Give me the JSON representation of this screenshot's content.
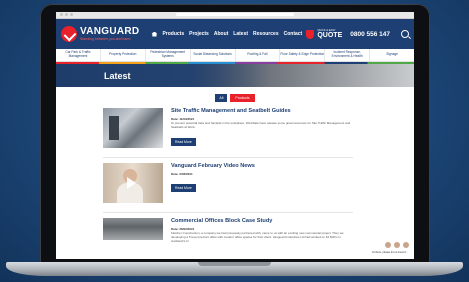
{
  "site": {
    "logo_name": "VANGUARD",
    "logo_tagline": "Standing between you and harm",
    "nav": [
      "Products",
      "Projects",
      "About",
      "Latest",
      "Resources",
      "Contact"
    ],
    "quote_small": "QUICK & EASY",
    "quote_big": "QUOTE",
    "phone": "0800 556 147",
    "categories": [
      "Car Park & Traffic Management",
      "Property Protection",
      "Pedestrian Management Systems",
      "Social Distancing Solutions",
      "Roofing & Fall",
      "Floor Safety & Edge Protection",
      "Incident Response, Environment & Health",
      "Signage"
    ],
    "hero_title": "Latest",
    "filters": {
      "all": "All",
      "products": "Products"
    }
  },
  "articles": [
    {
      "title": "Site Traffic Management and Seatbelt Guides",
      "date": "Date: 11/03/2021",
      "text": "To prevent potential risks and hazards in the workplace, WorkSafe have release some great resources for Site Traffic Management and Seatbelts at Work.",
      "button": "Read More"
    },
    {
      "title": "Vanguard February Video News",
      "date": "Date: 2/03/2021",
      "text": "",
      "button": "Read More"
    },
    {
      "title": "Commercial Offices Block Case Study",
      "date": "Date: 26/02/2021",
      "text": "Fletcher Construction, a company we had previously partnered with, came to us with an exciting new commercial project. They we developing a 5 level precinct office with modern office spaces for their client. Vanguard Industries Ltd had worked on 16,500m in Auckland's hi",
      "button": "Read More"
    }
  ],
  "chat": {
    "text": "Hi there, please let us know if..."
  },
  "colors": {
    "brand_blue": "#1d3f73",
    "brand_red": "#e8212b"
  }
}
